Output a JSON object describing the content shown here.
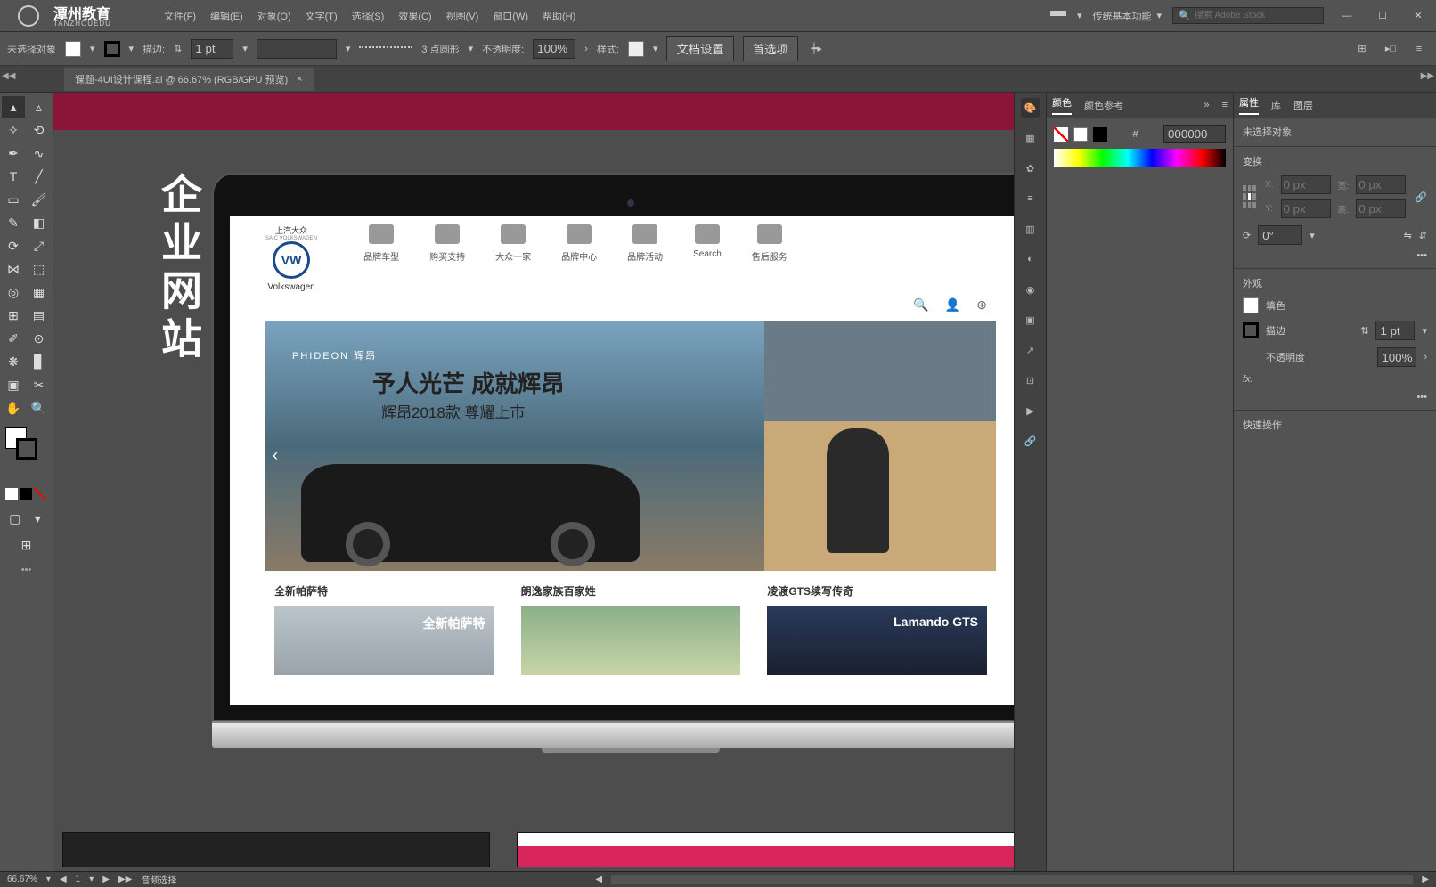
{
  "brand": {
    "name": "潭州教育",
    "sub": "TANZHOUEDU"
  },
  "menu": {
    "file": "文件(F)",
    "edit": "编辑(E)",
    "object": "对象(O)",
    "type": "文字(T)",
    "select": "选择(S)",
    "effect": "效果(C)",
    "view": "视图(V)",
    "window": "窗口(W)",
    "help": "帮助(H)"
  },
  "workspace": {
    "label": "传统基本功能"
  },
  "search": {
    "placeholder": "搜索 Adobe Stock"
  },
  "options": {
    "noSelection": "未选择对象",
    "strokeLabel": "描边:",
    "strokeVal": "1 pt",
    "dashLabel": "3 点圆形",
    "opacityLabel": "不透明度:",
    "opacityVal": "100%",
    "styleLabel": "样式:",
    "docSetup": "文档设置",
    "prefs": "首选项"
  },
  "tab": {
    "title": "课题-4UI设计课程.ai @ 66.67% (RGB/GPU 预览)"
  },
  "canvas": {
    "titleVert": "企业网站",
    "site": {
      "logoTop": "上汽大众",
      "logoSub": "SAIC VOLKSWAGEN",
      "logoName": "Volkswagen",
      "nav": [
        "品牌车型",
        "购买支持",
        "大众一家",
        "品牌中心",
        "品牌活动",
        "Search",
        "售后服务"
      ],
      "heroBrand": "PHIDEON 辉昂",
      "heroH2": "予人光芒 成就辉昂",
      "heroH3": "辉昂2018款  尊耀上市",
      "cards": [
        {
          "t": "全新帕萨特",
          "label": "全新帕萨特"
        },
        {
          "t": "朗逸家族百家姓",
          "label": ""
        },
        {
          "t": "凌渡GTS续写传奇",
          "label": "Lamando GTS"
        }
      ]
    }
  },
  "colorPanel": {
    "tab1": "颜色",
    "tab2": "颜色参考",
    "hexPrefix": "#",
    "hex": "000000"
  },
  "propPanel": {
    "tab1": "属性",
    "tab2": "库",
    "tab3": "图层",
    "noSel": "未选择对象",
    "transform": "变换",
    "x": "X:",
    "y": "Y:",
    "w": "宽:",
    "h": "高:",
    "placeholder": "0 px",
    "angle": "0°",
    "appearance": "外观",
    "fill": "填色",
    "stroke": "描边",
    "strokeVal": "1 pt",
    "opacity": "不透明度",
    "opacityVal": "100%",
    "fx": "fx.",
    "quick": "快速操作"
  },
  "status": {
    "zoom": "66.67%",
    "artboard": "1",
    "selInfo": "音频选择"
  }
}
